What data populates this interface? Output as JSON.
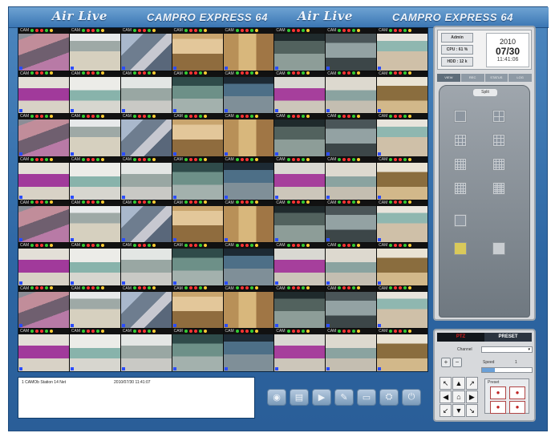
{
  "header": {
    "brand_1": "Air Live",
    "product_1": "CAMPRO EXPRESS 64",
    "brand_2": "Air Live",
    "product_2": "CAMPRO EXPRESS 64"
  },
  "status": {
    "user_label": "Admin",
    "cpu_label": "CPU : 61 %",
    "hdd_label": "HDD : 12 k",
    "year": "2010",
    "date": "07/30",
    "time": "11:41:06"
  },
  "panel_tabs": [
    {
      "label": "VIEW"
    },
    {
      "label": "REC"
    },
    {
      "label": "STATUS"
    },
    {
      "label": "LOG"
    }
  ],
  "split": {
    "caption": "Split"
  },
  "log": {
    "message": "1  CAMOb Station 14 Net",
    "timestamp": "2010/07/30 11:41:07"
  },
  "toolbar": [
    {
      "icon": "camera-icon",
      "glyph": "◉"
    },
    {
      "icon": "list-icon",
      "glyph": "▤"
    },
    {
      "icon": "play-icon",
      "glyph": "▶"
    },
    {
      "icon": "tools-icon",
      "glyph": "✎"
    },
    {
      "icon": "window-icon",
      "glyph": "▭"
    },
    {
      "icon": "network-icon",
      "glyph": "⛭"
    },
    {
      "icon": "power-icon",
      "glyph": "⏻"
    }
  ],
  "ptz": {
    "tab_active": "PTZ",
    "tab_preset": "PRESET",
    "channel_label": "Channel",
    "channel_value": "",
    "speed_label": "Speed",
    "speed_value": "1",
    "speed_fraction": 0.25,
    "preset_label": "Preset"
  },
  "camera_bar_text": "CAM"
}
